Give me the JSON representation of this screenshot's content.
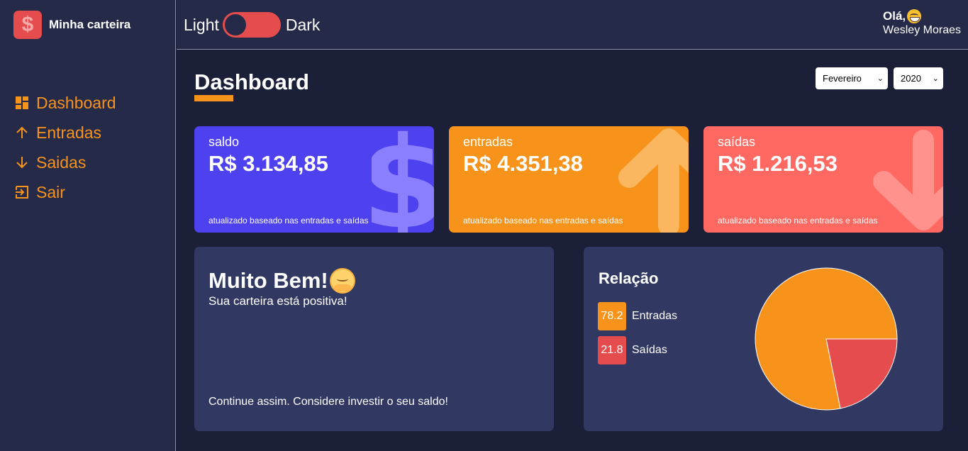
{
  "sidebar": {
    "brand_icon": "$",
    "brand_title": "Minha carteira",
    "items": [
      {
        "label": "Dashboard",
        "icon": "dashboard-icon"
      },
      {
        "label": "Entradas",
        "icon": "arrow-up-icon"
      },
      {
        "label": "Saidas",
        "icon": "arrow-down-icon"
      },
      {
        "label": "Sair",
        "icon": "exit-icon"
      }
    ]
  },
  "header": {
    "theme_light": "Light",
    "theme_dark": "Dark",
    "greeting": "Olá,",
    "greeting_emoji": "grinning-face-icon",
    "username": "Wesley Moraes"
  },
  "dashboard": {
    "title": "Dashboard",
    "month_select": "Fevereiro",
    "year_select": "2020"
  },
  "cards": [
    {
      "label": "saldo",
      "value": "R$ 3.134,85",
      "footer": "atualizado baseado nas entradas e saídas",
      "icon": "dollar-icon",
      "color": "#4e41f0"
    },
    {
      "label": "entradas",
      "value": "R$ 4.351,38",
      "footer": "atualizado baseado nas entradas e saídas",
      "icon": "arrow-up-icon",
      "color": "#f7931b"
    },
    {
      "label": "saídas",
      "value": "R$ 1.216,53",
      "footer": "atualizado baseado nas entradas e saídas",
      "icon": "arrow-down-icon",
      "color": "#ff6961"
    }
  ],
  "message": {
    "title": "Muito Bem!",
    "emoji": "hugging-face-icon",
    "subtitle": "Sua carteira está positiva!",
    "footer": "Continue assim. Considere investir o seu saldo!"
  },
  "relation": {
    "title": "Relação",
    "legend": [
      {
        "value": "78.2",
        "label": "Entradas",
        "color": "#f7931b"
      },
      {
        "value": "21.8",
        "label": "Saídas",
        "color": "#e44c4e"
      }
    ]
  },
  "colors": {
    "accent": "#f7931b",
    "danger": "#e44c4e",
    "primary": "#4e41f0",
    "background": "#1b1f38",
    "surface": "#252a48",
    "panel": "#313862"
  }
}
